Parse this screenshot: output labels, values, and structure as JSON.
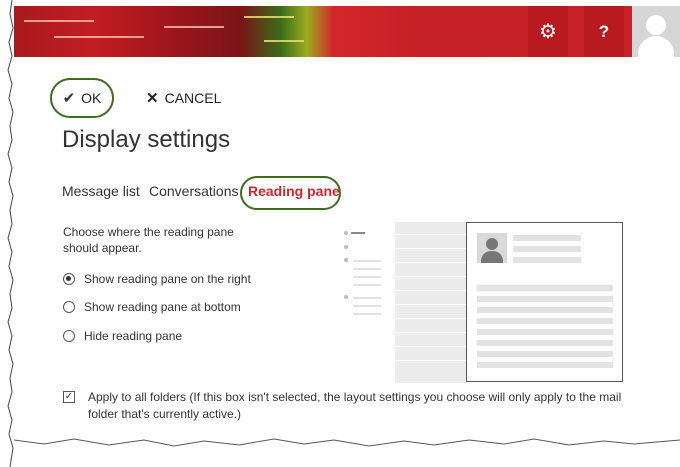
{
  "header": {
    "gear_icon": "gear-icon",
    "help_label": "?",
    "avatar_icon": "user-avatar-icon",
    "accent": "#c42026"
  },
  "actions": {
    "ok_label": "OK",
    "cancel_label": "CANCEL"
  },
  "page": {
    "title": "Display settings"
  },
  "tabs": [
    {
      "label": "Message list",
      "active": false
    },
    {
      "label": "Conversations",
      "active": false
    },
    {
      "label": "Reading pane",
      "active": true
    }
  ],
  "reading_pane": {
    "prompt": "Choose where the reading pane should appear.",
    "options": [
      {
        "label": "Show reading pane on the right",
        "selected": true
      },
      {
        "label": "Show reading pane at bottom",
        "selected": false
      },
      {
        "label": "Hide reading pane",
        "selected": false
      }
    ]
  },
  "apply_all": {
    "checked": true,
    "label": "Apply to all folders (If this box isn't selected, the layout settings you choose will only apply to the mail folder that's currently active.)"
  }
}
